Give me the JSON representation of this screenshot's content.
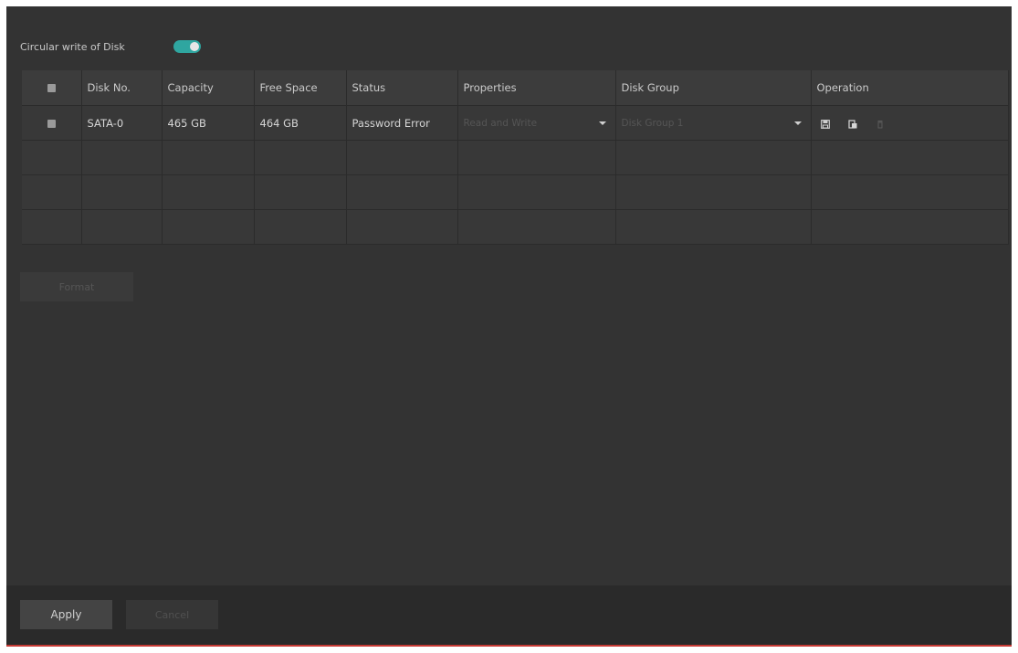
{
  "circular_write": {
    "label": "Circular write of Disk",
    "enabled": true,
    "accent": "#2fa6a0"
  },
  "table": {
    "columns": [
      "Disk No.",
      "Capacity",
      "Free Space",
      "Status",
      "Properties",
      "Disk Group",
      "Operation"
    ],
    "rows": [
      {
        "disk_no": "SATA-0",
        "capacity": "465 GB",
        "free_space": "464 GB",
        "status": "Password Error",
        "properties": "Read and Write",
        "disk_group": "Disk Group 1",
        "operations": [
          "save-icon",
          "lock-icon",
          "delete-icon"
        ]
      }
    ]
  },
  "format_button": "Format",
  "footer": {
    "apply": "Apply",
    "cancel": "Cancel"
  },
  "colors": {
    "panel": "#333333",
    "footer": "#2a2a2a",
    "accent_line": "#c53a34"
  }
}
